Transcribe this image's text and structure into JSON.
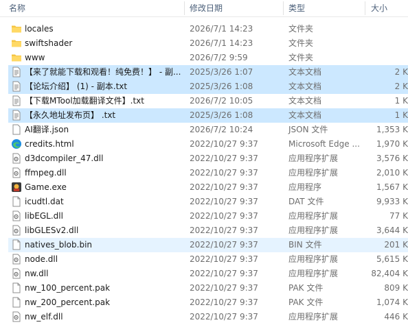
{
  "columns": {
    "name": "名称",
    "date": "修改日期",
    "type": "类型",
    "size": "大小"
  },
  "files": [
    {
      "name": "locales",
      "date": "2026/7/1 14:23",
      "type": "文件夹",
      "size": "",
      "icon": "folder-icon",
      "state": ""
    },
    {
      "name": "swiftshader",
      "date": "2026/7/1 14:23",
      "type": "文件夹",
      "size": "",
      "icon": "folder-icon",
      "state": ""
    },
    {
      "name": "www",
      "date": "2026/7/2 9:59",
      "type": "文件夹",
      "size": "",
      "icon": "folder-icon",
      "state": ""
    },
    {
      "name": "【来了就能下载和观看！纯免费！】 - 副...",
      "date": "2025/3/26 1:07",
      "type": "文本文档",
      "size": "2 K",
      "icon": "text-file-icon",
      "state": "selected"
    },
    {
      "name": "【论坛介绍】 (1) - 副本.txt",
      "date": "2025/3/26 1:08",
      "type": "文本文档",
      "size": "2 K",
      "icon": "text-file-icon",
      "state": "selected"
    },
    {
      "name": "【下载MTool加载翻译文件】.txt",
      "date": "2026/7/2 10:05",
      "type": "文本文档",
      "size": "1 K",
      "icon": "text-file-icon",
      "state": ""
    },
    {
      "name": "【永久地址发布页】 .txt",
      "date": "2025/3/26 1:08",
      "type": "文本文档",
      "size": "1 K",
      "icon": "text-file-icon",
      "state": "selected"
    },
    {
      "name": "AI翻译.json",
      "date": "2026/7/2 10:24",
      "type": "JSON 文件",
      "size": "1,353 K",
      "icon": "json-file-icon",
      "state": ""
    },
    {
      "name": "credits.html",
      "date": "2022/10/27 9:37",
      "type": "Microsoft Edge ...",
      "size": "1,970 K",
      "icon": "edge-icon",
      "state": ""
    },
    {
      "name": "d3dcompiler_47.dll",
      "date": "2022/10/27 9:37",
      "type": "应用程序扩展",
      "size": "3,576 K",
      "icon": "dll-file-icon",
      "state": ""
    },
    {
      "name": "ffmpeg.dll",
      "date": "2022/10/27 9:37",
      "type": "应用程序扩展",
      "size": "2,010 K",
      "icon": "dll-file-icon",
      "state": ""
    },
    {
      "name": "Game.exe",
      "date": "2022/10/27 9:37",
      "type": "应用程序",
      "size": "1,567 K",
      "icon": "game-exe-icon",
      "state": ""
    },
    {
      "name": "icudtl.dat",
      "date": "2022/10/27 9:37",
      "type": "DAT 文件",
      "size": "9,933 K",
      "icon": "blank-file-icon",
      "state": ""
    },
    {
      "name": "libEGL.dll",
      "date": "2022/10/27 9:37",
      "type": "应用程序扩展",
      "size": "77 K",
      "icon": "dll-file-icon",
      "state": ""
    },
    {
      "name": "libGLESv2.dll",
      "date": "2022/10/27 9:37",
      "type": "应用程序扩展",
      "size": "3,644 K",
      "icon": "dll-file-icon",
      "state": ""
    },
    {
      "name": "natives_blob.bin",
      "date": "2022/10/27 9:37",
      "type": "BIN 文件",
      "size": "201 K",
      "icon": "blank-file-icon",
      "state": "hover"
    },
    {
      "name": "node.dll",
      "date": "2022/10/27 9:37",
      "type": "应用程序扩展",
      "size": "5,615 K",
      "icon": "dll-file-icon",
      "state": ""
    },
    {
      "name": "nw.dll",
      "date": "2022/10/27 9:37",
      "type": "应用程序扩展",
      "size": "82,404 K",
      "icon": "dll-file-icon",
      "state": ""
    },
    {
      "name": "nw_100_percent.pak",
      "date": "2022/10/27 9:37",
      "type": "PAK 文件",
      "size": "809 K",
      "icon": "blank-file-icon",
      "state": ""
    },
    {
      "name": "nw_200_percent.pak",
      "date": "2022/10/27 9:37",
      "type": "PAK 文件",
      "size": "1,074 K",
      "icon": "blank-file-icon",
      "state": ""
    },
    {
      "name": "nw_elf.dll",
      "date": "2022/10/27 9:37",
      "type": "应用程序扩展",
      "size": "446 K",
      "icon": "dll-file-icon",
      "state": ""
    }
  ]
}
